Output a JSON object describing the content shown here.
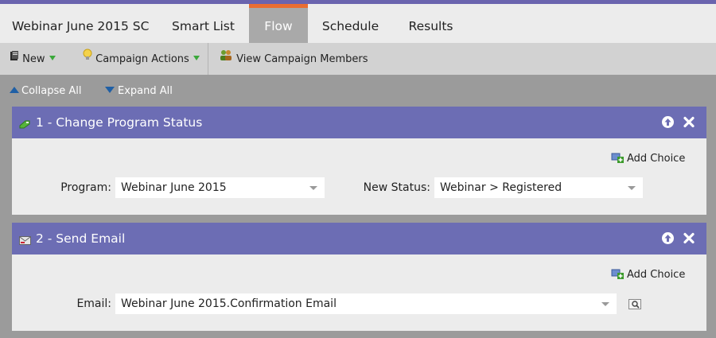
{
  "tabs": [
    {
      "label": "Webinar June 2015 SC",
      "active": false
    },
    {
      "label": "Smart List",
      "active": false
    },
    {
      "label": "Flow",
      "active": true
    },
    {
      "label": "Schedule",
      "active": false
    },
    {
      "label": "Results",
      "active": false
    }
  ],
  "toolbar": {
    "new_label": "New",
    "campaign_actions_label": "Campaign Actions",
    "view_members_label": "View Campaign Members"
  },
  "controls": {
    "collapse_label": "Collapse All",
    "expand_label": "Expand All"
  },
  "steps": [
    {
      "title": "1 - Change Program Status",
      "add_choice_label": "Add Choice",
      "fields": [
        {
          "label": "Program:",
          "value": "Webinar June 2015"
        },
        {
          "label": "New Status:",
          "value": "Webinar > Registered"
        }
      ]
    },
    {
      "title": "2 - Send Email",
      "add_choice_label": "Add Choice",
      "fields": [
        {
          "label": "Email:",
          "value": "Webinar June 2015.Confirmation Email"
        }
      ]
    }
  ],
  "colors": {
    "accent_tab": "#e96d32",
    "step_header": "#6c6db4",
    "top_strip": "#6a64ae",
    "workspace": "#9b9b9b"
  },
  "icons": {
    "new": "new-document-icon",
    "campaign_actions": "lightbulb-icon",
    "view_members": "people-icon",
    "step1": "program-status-icon",
    "step2": "email-icon",
    "move_up": "move-up-icon",
    "delete": "close-icon",
    "add_choice": "add-choice-icon",
    "preview": "preview-icon"
  }
}
